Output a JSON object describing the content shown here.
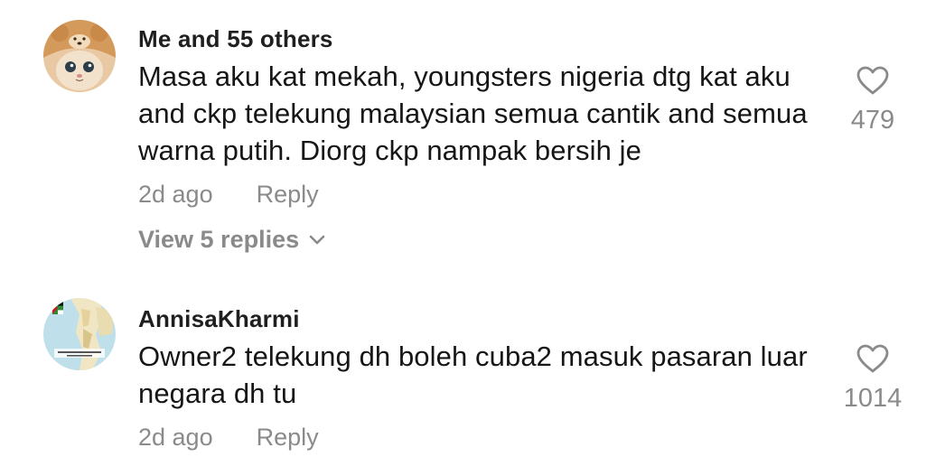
{
  "comments": [
    {
      "username": "Me and 55 others",
      "text": "Masa aku kat mekah, youngsters nigeria dtg kat aku and ckp telekung malaysian semua cantik and semua warna putih. Diorg ckp nampak bersih je",
      "time": "2d ago",
      "reply_label": "Reply",
      "view_replies": "View 5 replies",
      "likes": "479"
    },
    {
      "username": "AnnisaKharmi",
      "text": "Owner2 telekung dh boleh cuba2 masuk pasaran luar negara dh tu",
      "time": "2d ago",
      "reply_label": "Reply",
      "likes": "1014"
    }
  ],
  "colors": {
    "username": "#1f1f1f",
    "text": "#161616",
    "secondary": "#8a8a8a"
  },
  "icons": {
    "like": "heart-outline-icon",
    "expand": "chevron-down-icon"
  }
}
